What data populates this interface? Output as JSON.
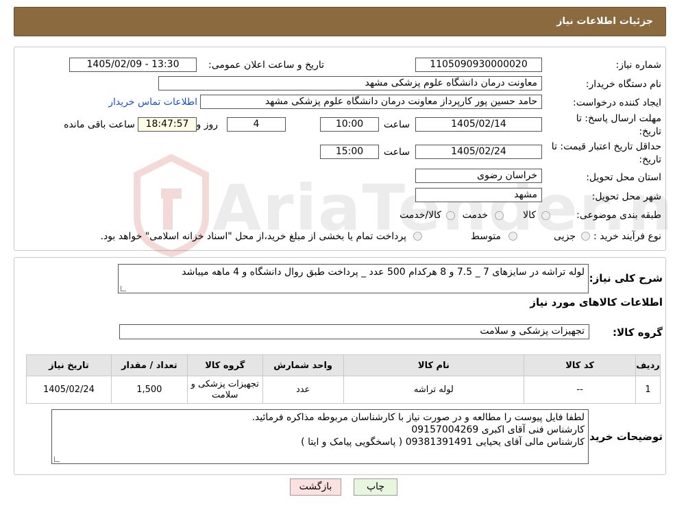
{
  "header": {
    "title": "جزئیات اطلاعات نیاز"
  },
  "fields": {
    "need_number_label": "شماره نیاز:",
    "need_number": "1105090930000020",
    "announce_label": "تاریخ و ساعت اعلان عمومی:",
    "announce_value": "1405/02/09 - 13:30",
    "buyer_org_label": "نام دستگاه خریدار:",
    "buyer_org": "معاونت درمان دانشگاه علوم پزشکی مشهد",
    "creator_label": "ایجاد کننده درخواست:",
    "creator": "حامد حسین پور کارپرداز معاونت درمان دانشگاه علوم پزشکی مشهد",
    "contact_link": "اطلاعات تماس خریدار",
    "deadline_label_1": "مهلت ارسال پاسخ: تا",
    "deadline_label_2": "تاریخ:",
    "deadline_date": "1405/02/14",
    "time_label": "ساعت",
    "deadline_time": "10:00",
    "days_value": "4",
    "days_label": "روز و",
    "remaining_time": "18:47:57",
    "remaining_label": "ساعت باقی مانده",
    "price_valid_label_1": "حداقل تاریخ اعتبار قیمت: تا",
    "price_valid_label_2": "تاریخ:",
    "price_valid_date": "1405/02/24",
    "price_valid_time": "15:00",
    "province_label": "استان محل تحویل:",
    "province": "خراسان رضوی",
    "city_label": "شهر محل تحویل:",
    "city": "مشهد",
    "category_label": "طبقه بندی موضوعی:",
    "category_options": [
      "کالا",
      "خدمت",
      "کالا/خدمت"
    ],
    "process_label": "نوع فرآیند خرید :",
    "process_options": [
      "جزیی",
      "متوسط"
    ],
    "process_note": "پرداخت تمام یا بخشی از مبلغ خرید،از محل \"اسناد خزانه اسلامی\" خواهد بود."
  },
  "watermark": "AriaTender.neT",
  "summary": {
    "label": "شرح کلی نیاز:",
    "text": "لوله تراشه در سایزهای 7 _ 7.5 و 8  هرکدام 500 عدد _ پرداخت طبق روال دانشگاه و 4 ماهه میباشد"
  },
  "goods_info_title": "اطلاعات کالاهای مورد نیاز",
  "goods_group": {
    "label": "گروه کالا:",
    "value": "تجهیزات پزشکی و سلامت"
  },
  "table": {
    "headers": [
      "ردیف",
      "کد کالا",
      "نام کالا",
      "واحد شمارش",
      "گروه کالا",
      "تعداد / مقدار",
      "تاریخ نیاز"
    ],
    "rows": [
      [
        "1",
        "--",
        "لوله تراشه",
        "عدد",
        "تجهیزات پزشکی و سلامت",
        "1,500",
        "1405/02/24"
      ]
    ]
  },
  "buyer_notes": {
    "label": "توضیحات خریدار:",
    "lines": [
      "لطفا فایل پیوست را مطالعه و در صورت نیاز با کارشناسان مربوطه مذاکره فرمائید.",
      "کارشناس فنی آقای اکبری 09157004269",
      "کارشناس مالی آقای  یحیایی 09381391491 ( پاسخگویی پیامک و ایتا )"
    ]
  },
  "buttons": {
    "print": "چاپ",
    "back": "بازگشت"
  }
}
